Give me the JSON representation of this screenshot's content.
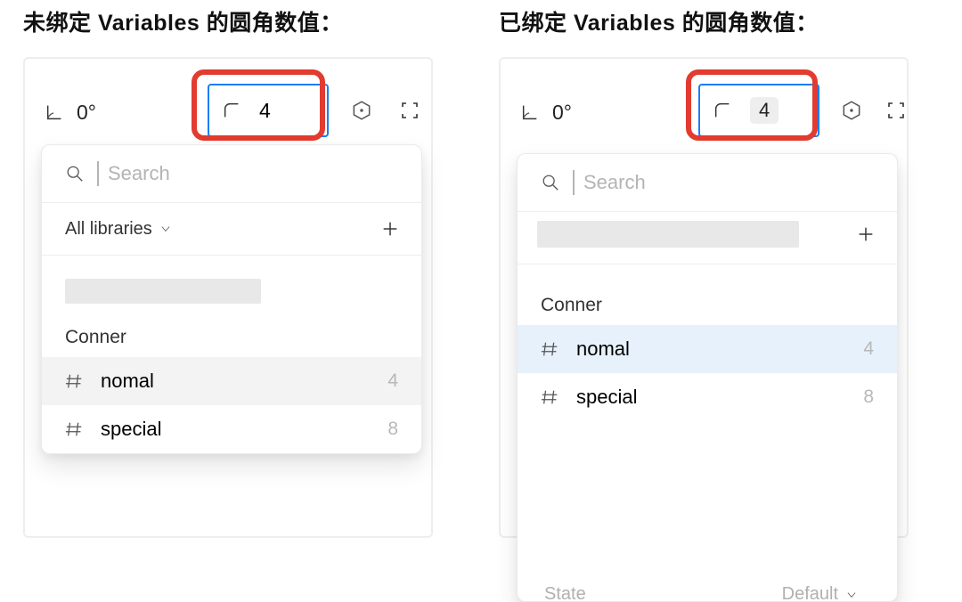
{
  "left": {
    "heading": "未绑定 Variables 的圆角数值：",
    "rotation": "0°",
    "radius_value": "4",
    "search_placeholder": "Search",
    "libraries_label": "All libraries",
    "section_label": "Conner",
    "items": [
      {
        "name": "nomal",
        "value": "4"
      },
      {
        "name": "special",
        "value": "8"
      }
    ]
  },
  "right": {
    "heading": "已绑定 Variables 的圆角数值：",
    "rotation": "0°",
    "radius_value": "4",
    "search_placeholder": "Search",
    "section_label": "Conner",
    "items": [
      {
        "name": "nomal",
        "value": "4"
      },
      {
        "name": "special",
        "value": "8"
      }
    ],
    "state_label": "State",
    "state_value": "Default"
  }
}
